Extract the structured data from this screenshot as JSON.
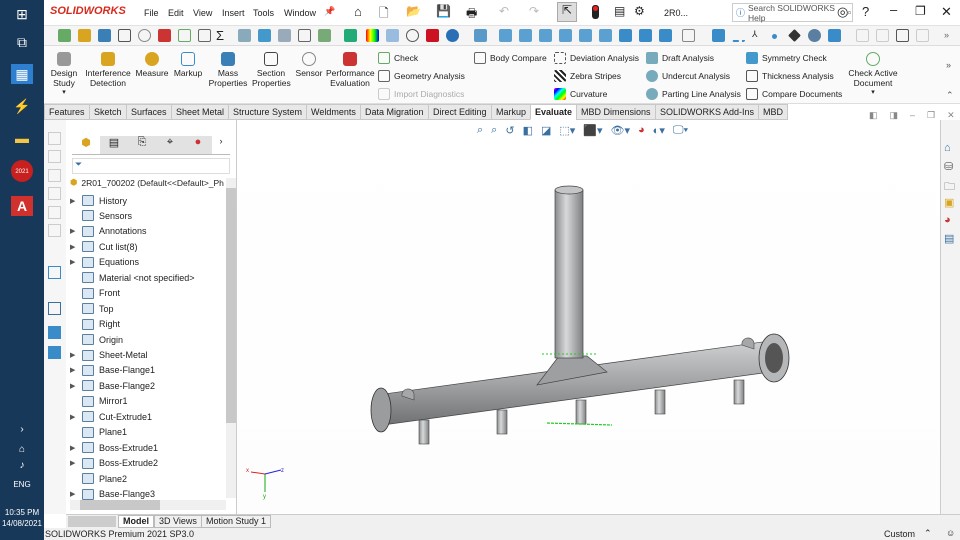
{
  "taskbar": {
    "time": "10:35 PM",
    "date": "14/08/2021",
    "lang": "ENG",
    "sw_badge": "2021"
  },
  "app": {
    "logo": "SOLIDWORKS",
    "doc_short": "2R0...",
    "search_placeholder": "Search SOLIDWORKS Help"
  },
  "menu": [
    "File",
    "Edit",
    "View",
    "Insert",
    "Tools",
    "Window"
  ],
  "command_manager": {
    "large_buttons": [
      {
        "label": "Design\nStudy"
      },
      {
        "label": "Interference\nDetection"
      },
      {
        "label": "Measure"
      },
      {
        "label": "Markup"
      },
      {
        "label": "Mass\nProperties"
      },
      {
        "label": "Section\nProperties"
      },
      {
        "label": "Sensor"
      },
      {
        "label": "Performance\nEvaluation"
      }
    ],
    "small_buttons": [
      "Check",
      "Geometry Analysis",
      "Import Diagnostics",
      "Body Compare",
      "Deviation Analysis",
      "Zebra Stripes",
      "Curvature",
      "Draft Analysis",
      "Undercut Analysis",
      "Parting Line Analysis",
      "Symmetry Check",
      "Thickness Analysis",
      "Compare Documents"
    ],
    "check_active": "Check Active\nDocument"
  },
  "tabs": [
    "Features",
    "Sketch",
    "Surfaces",
    "Sheet Metal",
    "Structure System",
    "Weldments",
    "Data Migration",
    "Direct Editing",
    "Markup",
    "Evaluate",
    "MBD Dimensions",
    "SOLIDWORKS Add-Ins",
    "MBD"
  ],
  "active_tab": "Evaluate",
  "tree": {
    "root": "2R01_700202  (Default<<Default>_Ph",
    "items": [
      {
        "label": "History",
        "exp": true
      },
      {
        "label": "Sensors",
        "exp": false
      },
      {
        "label": "Annotations",
        "exp": true
      },
      {
        "label": "Cut list(8)",
        "exp": true
      },
      {
        "label": "Equations",
        "exp": true
      },
      {
        "label": "Material <not specified>",
        "exp": false
      },
      {
        "label": "Front",
        "exp": false
      },
      {
        "label": "Top",
        "exp": false
      },
      {
        "label": "Right",
        "exp": false
      },
      {
        "label": "Origin",
        "exp": false
      },
      {
        "label": "Sheet-Metal",
        "exp": true
      },
      {
        "label": "Base-Flange1",
        "exp": true
      },
      {
        "label": "Base-Flange2",
        "exp": true
      },
      {
        "label": "Mirror1",
        "exp": false
      },
      {
        "label": "Cut-Extrude1",
        "exp": true
      },
      {
        "label": "Plane1",
        "exp": false
      },
      {
        "label": "Boss-Extrude1",
        "exp": true
      },
      {
        "label": "Boss-Extrude2",
        "exp": true
      },
      {
        "label": "Plane2",
        "exp": false
      },
      {
        "label": "Base-Flange3",
        "exp": true
      }
    ]
  },
  "bottom_tabs": [
    "Model",
    "3D Views",
    "Motion Study 1"
  ],
  "status": {
    "product": "SOLIDWORKS Premium 2021 SP3.0",
    "units": "Custom"
  },
  "colors": {
    "taskbar": "#18385a",
    "accent": "#d52b1e",
    "part": "#a9abad"
  }
}
